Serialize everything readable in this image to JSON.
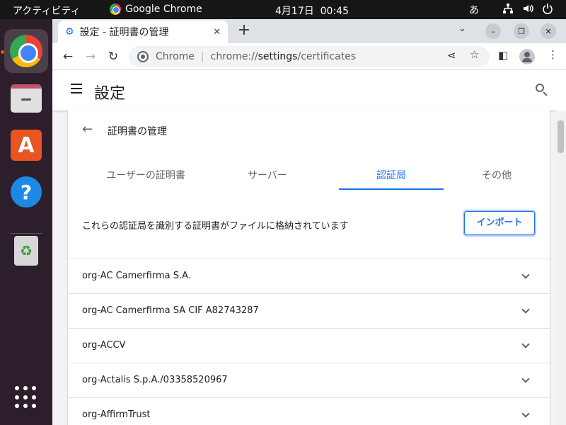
{
  "topbar": {
    "activities": "アクティビティ",
    "app_name": "Google Chrome",
    "date": "4月17日",
    "time": "00:45",
    "ime": "あ",
    "tray_icons": [
      "network-icon",
      "volume-icon",
      "power-icon"
    ]
  },
  "dock": {
    "items": [
      "chrome-icon",
      "files-icon",
      "app-store-icon",
      "help-icon",
      "trash-icon"
    ],
    "apps_button": "show-apps-icon"
  },
  "browser": {
    "tab": {
      "title": "設定 - 証明書の管理"
    },
    "omnibox": {
      "chip": "Chrome",
      "url_prefix": "chrome://",
      "url_host": "settings",
      "url_path": "/certificates"
    }
  },
  "settings": {
    "title": "設定",
    "subpage_title": "証明書の管理",
    "tabs": [
      {
        "label": "ユーザーの証明書"
      },
      {
        "label": "サーバー"
      },
      {
        "label": "認証局"
      },
      {
        "label": "その他"
      }
    ],
    "selected_tab": "認証局",
    "description": "これらの認証局を識別する証明書がファイルに格納されています",
    "import_label": "インポート",
    "authorities": [
      {
        "name": "org-AC Camerfirma S.A."
      },
      {
        "name": "org-AC Camerfirma SA CIF A82743287"
      },
      {
        "name": "org-ACCV"
      },
      {
        "name": "org-Actalis S.p.A./03358520967"
      },
      {
        "name": "org-AffirmTrust"
      }
    ]
  },
  "colors": {
    "accent": "#1a73e8",
    "dock_bg": "#2c1e2a",
    "topbar_bg": "#161616",
    "ubuntu_orange": "#e95420"
  }
}
